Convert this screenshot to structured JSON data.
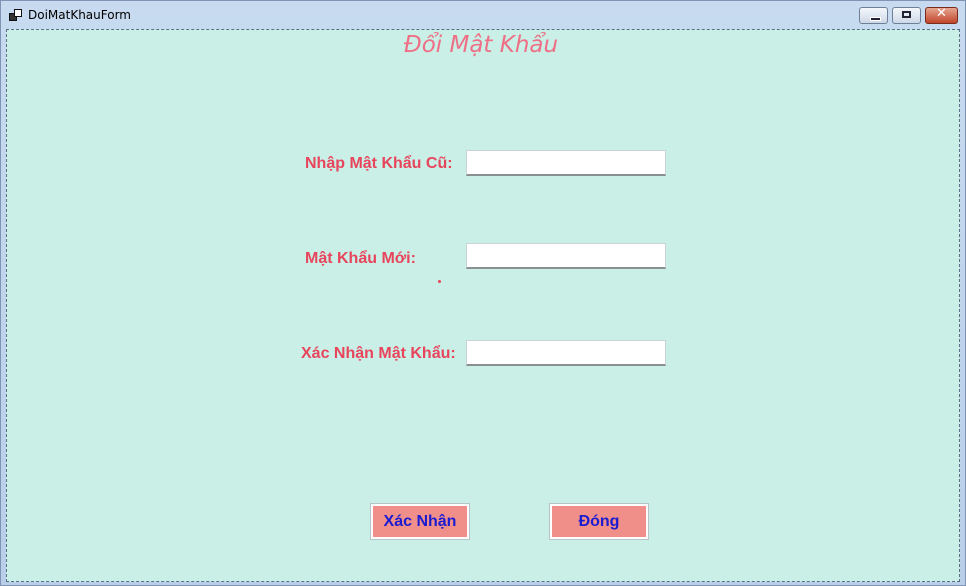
{
  "window": {
    "title": "DoiMatKhauForm",
    "icon": "app-form-icon",
    "controls": {
      "minimize": "minimize-icon",
      "maximize": "maximize-icon",
      "close_glyph": "✕"
    }
  },
  "form": {
    "heading": "Đổi Mật Khẩu",
    "fields": [
      {
        "label": "Nhập Mật Khẩu Cũ:",
        "value": ""
      },
      {
        "label": "Mật Khẩu Mới:",
        "value": ""
      },
      {
        "label": "Xác Nhận Mật Khẩu:",
        "value": ""
      }
    ],
    "buttons": {
      "confirm": "Xác Nhận",
      "close": "Đóng"
    }
  },
  "colors": {
    "background": "#c9efe6",
    "label": "#e8455d",
    "heading": "#ee6f86",
    "button_fill": "#f08f8a",
    "button_text": "#1b1bd2"
  }
}
